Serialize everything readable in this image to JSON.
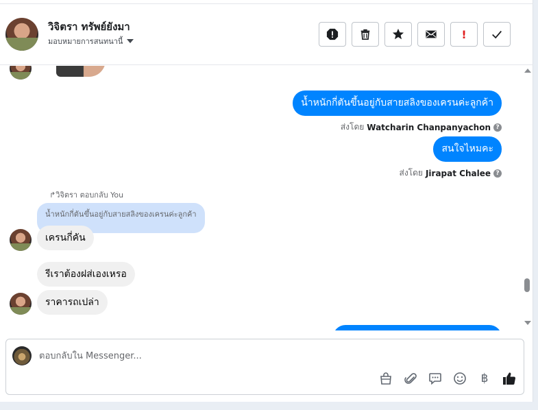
{
  "header": {
    "name": "วิจิตรา ทรัพย์ยังมา",
    "assign_label": "มอบหมายการสนทนานี้",
    "actions": [
      "spam-icon",
      "trash-icon",
      "star-icon",
      "envelope-icon",
      "important-icon",
      "check-icon"
    ],
    "important_glyph": "!"
  },
  "messages": {
    "out1": "น้ำหนักกี่ตันขึ้นอยู่กับสายสลิงของเครนค่ะลูกค้า",
    "sentby1_prefix": "ส่งโดย",
    "sentby1_name": "Watcharin Chanpanyachon",
    "out2": "สนใจไหมคะ",
    "sentby2_prefix": "ส่งโดย",
    "sentby2_name": "Jirapat Chalee",
    "reply_line": "วิจิตรา ตอบกลับ You",
    "quoted": "น้ำหนักกี่ตันขึ้นอยู่กับสายสลิงของเครนค่ะลูกค้า",
    "in1": "เครนกี่คัน",
    "in2": "รีเราต้องฝส่เองเหรอ",
    "in3": "ราคารถเปล่า"
  },
  "composer": {
    "placeholder": "ตอบกลับใน Messenger...",
    "tools": [
      "bag-icon",
      "paperclip-icon",
      "saved-reply-icon",
      "emoji-icon",
      "baht-icon",
      "thumbs-up-icon"
    ],
    "baht_glyph": "฿"
  },
  "colors": {
    "outgoing_bubble": "#0084ff",
    "incoming_bubble": "#f0f0f0",
    "quoted_bubble": "#cfe1fb"
  }
}
